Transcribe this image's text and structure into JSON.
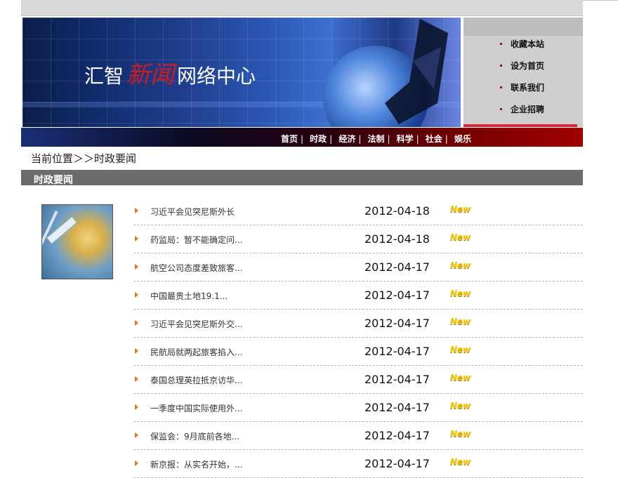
{
  "banner": {
    "logo_part1": "汇智",
    "logo_script": "新闻",
    "logo_part2": "网络中心"
  },
  "side_links": [
    "收藏本站",
    "设为首页",
    "联系我们",
    "企业招聘"
  ],
  "nav": [
    "首页",
    "时政",
    "经济",
    "法制",
    "科学",
    "社会",
    "娱乐"
  ],
  "nav_separator": "|",
  "breadcrumb": "当前位置＞＞时政要闻",
  "section_title": "时政要闻",
  "news": [
    {
      "title": "习近平会见突尼斯外长",
      "date": "2012-04-18",
      "badge": "New"
    },
    {
      "title": "药监局：暂不能确定问...",
      "date": "2012-04-18",
      "badge": "New"
    },
    {
      "title": "航空公司态度差致旅客...",
      "date": "2012-04-17",
      "badge": "New"
    },
    {
      "title": "中国最贵土地19.1...",
      "date": "2012-04-17",
      "badge": "New"
    },
    {
      "title": "习近平会见突尼斯外交...",
      "date": "2012-04-17",
      "badge": "New"
    },
    {
      "title": "民航局就两起旅客掐入...",
      "date": "2012-04-17",
      "badge": "New"
    },
    {
      "title": "泰国总理英拉抵京访华...",
      "date": "2012-04-17",
      "badge": "New"
    },
    {
      "title": "一季度中国实际使用外...",
      "date": "2012-04-17",
      "badge": "New"
    },
    {
      "title": "保监会：9月底前各地...",
      "date": "2012-04-17",
      "badge": "New"
    },
    {
      "title": "新京报：从实名开始，...",
      "date": "2012-04-17",
      "badge": "New"
    }
  ],
  "colors": {
    "nav_dark": "#0a0a22",
    "nav_red": "#a00000",
    "section_bar": "#6b6b6b",
    "arrow": "#e07a12",
    "badge": "#f2c600"
  }
}
